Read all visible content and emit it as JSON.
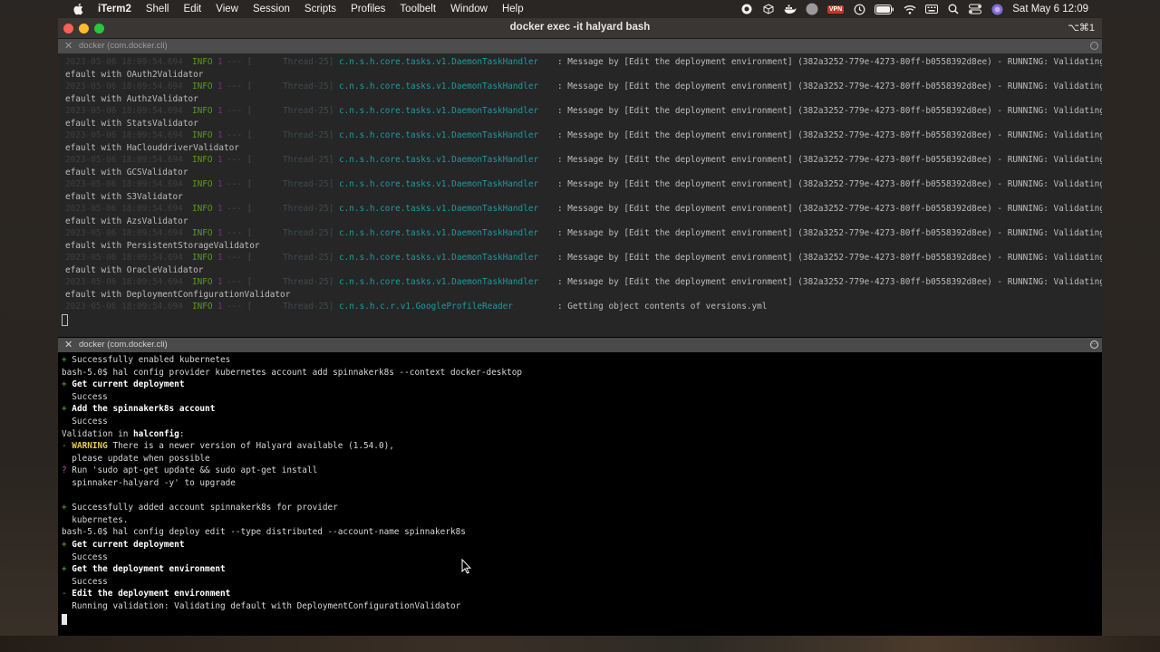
{
  "menubar": {
    "app_name": "iTerm2",
    "menus": [
      "Shell",
      "Edit",
      "View",
      "Session",
      "Scripts",
      "Profiles",
      "Toolbelt",
      "Window",
      "Help"
    ],
    "vpn_label": "VPN",
    "clock": "Sat May 6  12:09"
  },
  "window": {
    "title": "docker exec -it halyard bash",
    "shortcut": "⌥⌘1"
  },
  "pane_top": {
    "label": "docker (com.docker.cli)",
    "log_lines": [
      {
        "ts": "2023-05-06 18:09:54.694",
        "level": "INFO",
        "pid": "1",
        "sep": "--- [",
        "thread": "Thread-25]",
        "cls": "c.n.s.h.core.tasks.v1.DaemonTaskHandler",
        "msg": ": Message by [Edit the deployment environment] (382a3252-779e-4273-80ff-b0558392d8ee) - RUNNING: Validating d",
        "cont": "efault with OAuth2Validator"
      },
      {
        "ts": "2023-05-06 18:09:54.694",
        "level": "INFO",
        "pid": "1",
        "sep": "--- [",
        "thread": "Thread-25]",
        "cls": "c.n.s.h.core.tasks.v1.DaemonTaskHandler",
        "msg": ": Message by [Edit the deployment environment] (382a3252-779e-4273-80ff-b0558392d8ee) - RUNNING: Validating d",
        "cont": "efault with AuthzValidator"
      },
      {
        "ts": "2023-05-06 18:09:54.694",
        "level": "INFO",
        "pid": "1",
        "sep": "--- [",
        "thread": "Thread-25]",
        "cls": "c.n.s.h.core.tasks.v1.DaemonTaskHandler",
        "msg": ": Message by [Edit the deployment environment] (382a3252-779e-4273-80ff-b0558392d8ee) - RUNNING: Validating d",
        "cont": "efault with StatsValidator"
      },
      {
        "ts": "2023-05-06 18:09:54.694",
        "level": "INFO",
        "pid": "1",
        "sep": "--- [",
        "thread": "Thread-25]",
        "cls": "c.n.s.h.core.tasks.v1.DaemonTaskHandler",
        "msg": ": Message by [Edit the deployment environment] (382a3252-779e-4273-80ff-b0558392d8ee) - RUNNING: Validating d",
        "cont": "efault with HaClouddriverValidator"
      },
      {
        "ts": "2023-05-06 18:09:54.694",
        "level": "INFO",
        "pid": "1",
        "sep": "--- [",
        "thread": "Thread-25]",
        "cls": "c.n.s.h.core.tasks.v1.DaemonTaskHandler",
        "msg": ": Message by [Edit the deployment environment] (382a3252-779e-4273-80ff-b0558392d8ee) - RUNNING: Validating d",
        "cont": "efault with GCSValidator"
      },
      {
        "ts": "2023-05-06 18:09:54.694",
        "level": "INFO",
        "pid": "1",
        "sep": "--- [",
        "thread": "Thread-25]",
        "cls": "c.n.s.h.core.tasks.v1.DaemonTaskHandler",
        "msg": ": Message by [Edit the deployment environment] (382a3252-779e-4273-80ff-b0558392d8ee) - RUNNING: Validating d",
        "cont": "efault with S3Validator"
      },
      {
        "ts": "2023-05-06 18:09:54.694",
        "level": "INFO",
        "pid": "1",
        "sep": "--- [",
        "thread": "Thread-25]",
        "cls": "c.n.s.h.core.tasks.v1.DaemonTaskHandler",
        "msg": ": Message by [Edit the deployment environment] (382a3252-779e-4273-80ff-b0558392d8ee) - RUNNING: Validating d",
        "cont": "efault with AzsValidator"
      },
      {
        "ts": "2023-05-06 18:09:54.694",
        "level": "INFO",
        "pid": "1",
        "sep": "--- [",
        "thread": "Thread-25]",
        "cls": "c.n.s.h.core.tasks.v1.DaemonTaskHandler",
        "msg": ": Message by [Edit the deployment environment] (382a3252-779e-4273-80ff-b0558392d8ee) - RUNNING: Validating d",
        "cont": "efault with PersistentStorageValidator"
      },
      {
        "ts": "2023-05-06 18:09:54.694",
        "level": "INFO",
        "pid": "1",
        "sep": "--- [",
        "thread": "Thread-25]",
        "cls": "c.n.s.h.core.tasks.v1.DaemonTaskHandler",
        "msg": ": Message by [Edit the deployment environment] (382a3252-779e-4273-80ff-b0558392d8ee) - RUNNING: Validating d",
        "cont": "efault with OracleValidator"
      },
      {
        "ts": "2023-05-06 18:09:54.694",
        "level": "INFO",
        "pid": "1",
        "sep": "--- [",
        "thread": "Thread-25]",
        "cls": "c.n.s.h.core.tasks.v1.DaemonTaskHandler",
        "msg": ": Message by [Edit the deployment environment] (382a3252-779e-4273-80ff-b0558392d8ee) - RUNNING: Validating d",
        "cont": "efault with DeploymentConfigurationValidator"
      },
      {
        "ts": "2023-05-06 18:09:54.694",
        "level": "INFO",
        "pid": "1",
        "sep": "--- [",
        "thread": "Thread-25]",
        "cls": "c.n.s.h.c.r.v1.GoogleProfileReader",
        "msg": ": Getting object contents of versions.yml",
        "cont": ""
      }
    ]
  },
  "pane_bottom": {
    "label": "docker (com.docker.cli)",
    "lines": [
      [
        {
          "t": "+ ",
          "s": "plus"
        },
        {
          "t": "Successfully enabled kubernetes",
          "s": "out"
        }
      ],
      [
        {
          "t": "bash-5.0$ hal config provider kubernetes account add spinnakerk8s --context docker-desktop",
          "s": "out"
        }
      ],
      [
        {
          "t": "+ ",
          "s": "plus"
        },
        {
          "t": "Get current deployment",
          "s": "bold"
        }
      ],
      [
        {
          "t": "  Success",
          "s": "out"
        }
      ],
      [
        {
          "t": "+ ",
          "s": "plus"
        },
        {
          "t": "Add the spinnakerk8s account",
          "s": "bold"
        }
      ],
      [
        {
          "t": "  Success",
          "s": "out"
        }
      ],
      [
        {
          "t": "Validation in ",
          "s": "out"
        },
        {
          "t": "halconfig",
          "s": "bold"
        },
        {
          "t": ":",
          "s": "out"
        }
      ],
      [
        {
          "t": "- ",
          "s": "minus"
        },
        {
          "t": "WARNING",
          "s": "warn"
        },
        {
          "t": " There is a newer version of Halyard available (1.54.0),",
          "s": "out"
        }
      ],
      [
        {
          "t": "  please update when possible",
          "s": "out"
        }
      ],
      [
        {
          "t": "? ",
          "s": "q"
        },
        {
          "t": "Run 'sudo apt-get update && sudo apt-get install",
          "s": "out"
        }
      ],
      [
        {
          "t": "  spinnaker-halyard -y' to upgrade",
          "s": "out"
        }
      ],
      [
        {
          "t": "",
          "s": "out"
        }
      ],
      [
        {
          "t": "+ ",
          "s": "plus"
        },
        {
          "t": "Successfully added account spinnakerk8s for provider",
          "s": "out"
        }
      ],
      [
        {
          "t": "  kubernetes.",
          "s": "out"
        }
      ],
      [
        {
          "t": "bash-5.0$ hal config deploy edit --type distributed --account-name spinnakerk8s",
          "s": "out"
        }
      ],
      [
        {
          "t": "+ ",
          "s": "plus"
        },
        {
          "t": "Get current deployment",
          "s": "bold"
        }
      ],
      [
        {
          "t": "  Success",
          "s": "out"
        }
      ],
      [
        {
          "t": "+ ",
          "s": "plus"
        },
        {
          "t": "Get the deployment environment",
          "s": "bold"
        }
      ],
      [
        {
          "t": "  Success",
          "s": "out"
        }
      ],
      [
        {
          "t": "- ",
          "s": "minus"
        },
        {
          "t": "Edit the deployment environment",
          "s": "bold"
        }
      ],
      [
        {
          "t": "  Running validation: Validating default with DeploymentConfigurationValidator",
          "s": "out"
        }
      ]
    ]
  }
}
